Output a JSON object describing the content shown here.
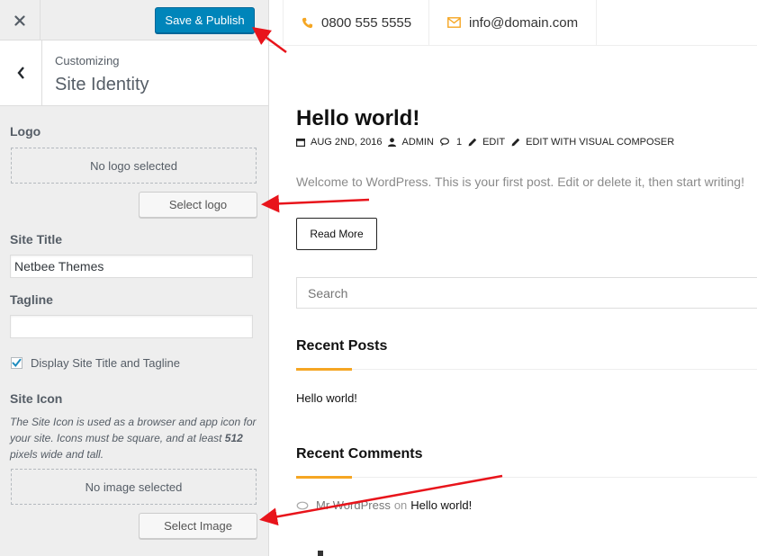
{
  "colors": {
    "publish_blue": "#0085ba",
    "accent_orange": "#f5a623",
    "arrow_red": "#e8141b"
  },
  "customizer": {
    "close_icon": "close-icon",
    "publish_label": "Save & Publish",
    "back_icon": "chevron-left-icon",
    "customizing_label": "Customizing",
    "section_title": "Site Identity",
    "logo": {
      "label": "Logo",
      "placeholder": "No logo selected",
      "button_label": "Select logo"
    },
    "site_title": {
      "label": "Site Title",
      "value": "Netbee Themes"
    },
    "tagline": {
      "label": "Tagline",
      "value": ""
    },
    "display_title_tagline": {
      "label": "Display Site Title and Tagline",
      "checked": true
    },
    "site_icon": {
      "label": "Site Icon",
      "description_before": "The Site Icon is used as a browser and app icon for your site. Icons must be square, and at least ",
      "description_bold": "512",
      "description_after": " pixels wide and tall.",
      "placeholder": "No image selected",
      "button_label": "Select Image"
    }
  },
  "preview": {
    "topbar": {
      "phone_icon": "phone-icon",
      "phone": "0800 555 5555",
      "email_icon": "envelope-icon",
      "email": "info@domain.com"
    },
    "post": {
      "title": "Hello world!",
      "date_icon": "calendar-icon",
      "date": "AUG 2ND, 2016",
      "author_icon": "user-icon",
      "author": "ADMIN",
      "comments_icon": "comments-icon",
      "comments_count": "1",
      "edit_icon": "pencil-icon",
      "edit_label": "EDIT",
      "vc_icon": "pencil-icon",
      "vc_label": "EDIT WITH VISUAL COMPOSER",
      "excerpt": "Welcome to WordPress. This is your first post. Edit or delete it, then start writing!",
      "read_more": "Read More"
    },
    "search": {
      "placeholder": "Search"
    },
    "recent_posts": {
      "title": "Recent Posts",
      "items": [
        "Hello world!"
      ]
    },
    "recent_comments": {
      "title": "Recent Comments",
      "items": [
        {
          "author": "Mr WordPress",
          "on": "on",
          "post": "Hello world!"
        }
      ]
    }
  }
}
